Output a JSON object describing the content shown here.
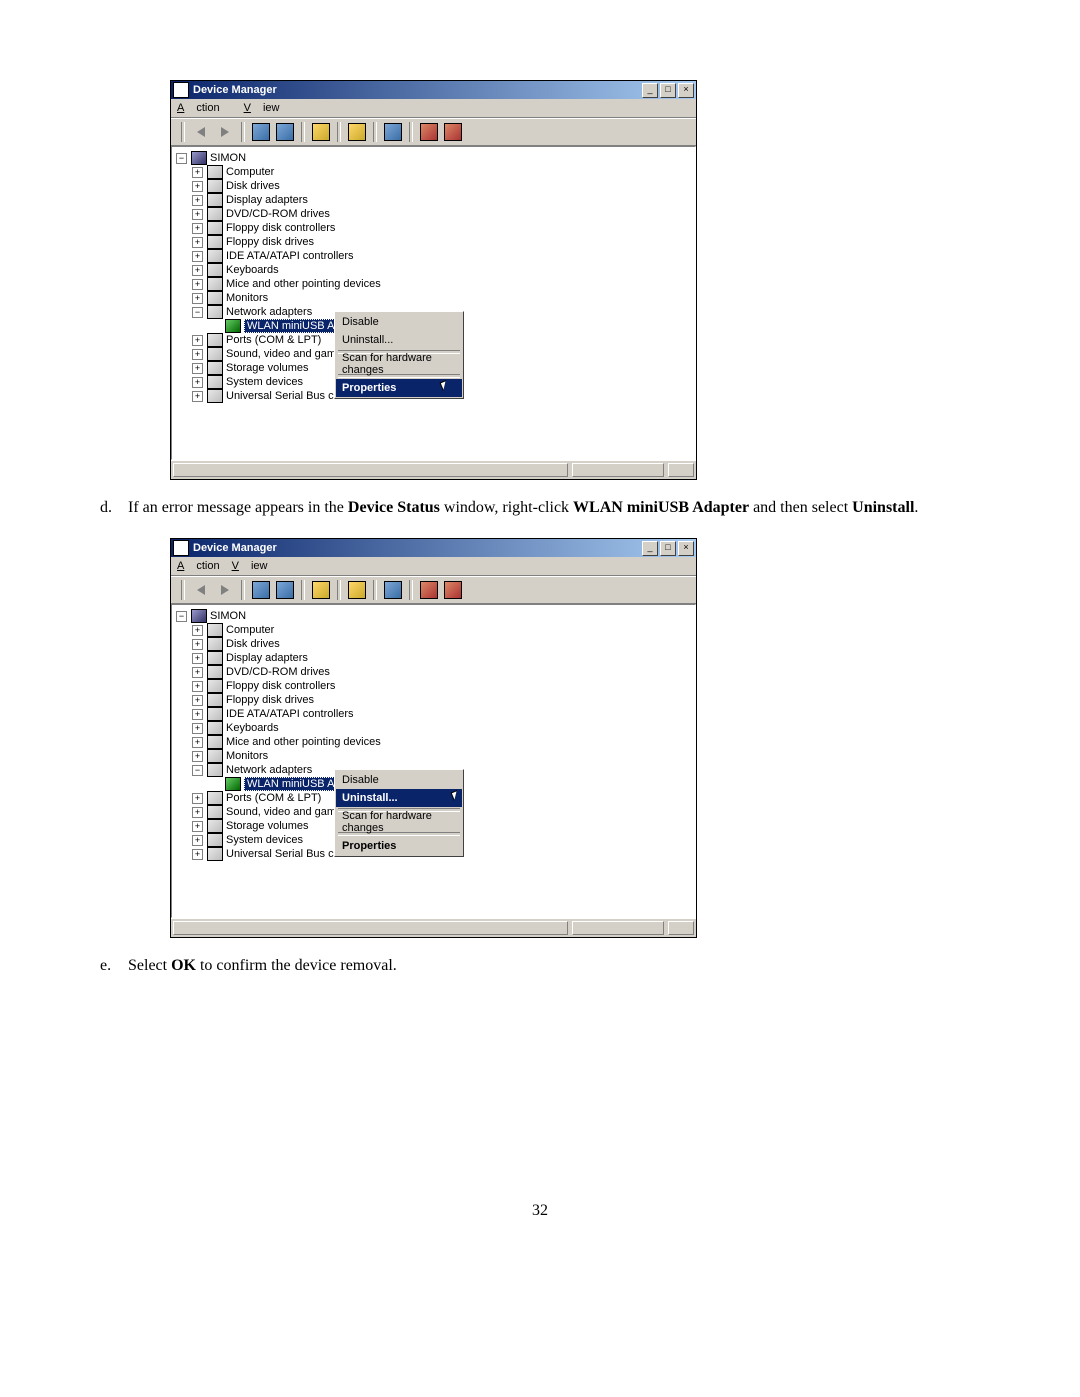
{
  "screenshot1": {
    "window_title": "Device Manager",
    "menu_action": "Action",
    "menu_view": "View",
    "root": "SIMON",
    "items": [
      "Computer",
      "Disk drives",
      "Display adapters",
      "DVD/CD-ROM drives",
      "Floppy disk controllers",
      "Floppy disk drives",
      "IDE ATA/ATAPI controllers",
      "Keyboards",
      "Mice and other pointing devices",
      "Monitors",
      "Network adapters"
    ],
    "selected_leaf": "WLAN miniUSB Adapter",
    "after_items": [
      "Ports (COM & LPT)",
      "Sound, video and game con",
      "Storage volumes",
      "System devices",
      "Universal Serial Bus control"
    ],
    "context_menu": {
      "disable": "Disable",
      "uninstall": "Uninstall...",
      "scan": "Scan for hardware changes",
      "properties": "Properties"
    },
    "highlighted_context_item": "properties",
    "highlighted_context_text": "Properties"
  },
  "instruction_d": {
    "letter": "d.",
    "pre_text": "If an error message appears in the ",
    "bold1": "Device Status",
    "mid1": " window, right-click ",
    "bold2": "WLAN miniUSB Adapter",
    "mid2": " and then select ",
    "bold3": "Uninstall",
    "end": "."
  },
  "screenshot2": {
    "window_title": "Device Manager",
    "menu_action": "Action",
    "menu_view": "View",
    "root": "SIMON",
    "items": [
      "Computer",
      "Disk drives",
      "Display adapters",
      "DVD/CD-ROM drives",
      "Floppy disk controllers",
      "Floppy disk drives",
      "IDE ATA/ATAPI controllers",
      "Keyboards",
      "Mice and other pointing devices",
      "Monitors",
      "Network adapters"
    ],
    "selected_leaf": "WLAN miniUSB Adapter",
    "after_items": [
      "Ports (COM & LPT)",
      "Sound, video and game con",
      "Storage volumes",
      "System devices",
      "Universal Serial Bus control"
    ],
    "context_menu": {
      "disable": "Disable",
      "uninstall": "Uninstall...",
      "scan": "Scan for hardware changes",
      "properties": "Properties"
    },
    "highlighted_context_item": "uninstall",
    "highlighted_context_text": "Uninstall..."
  },
  "instruction_e": {
    "letter": "e.",
    "pre_text": "Select ",
    "bold1": "OK",
    "end": " to confirm the device removal."
  },
  "page_number": "32"
}
